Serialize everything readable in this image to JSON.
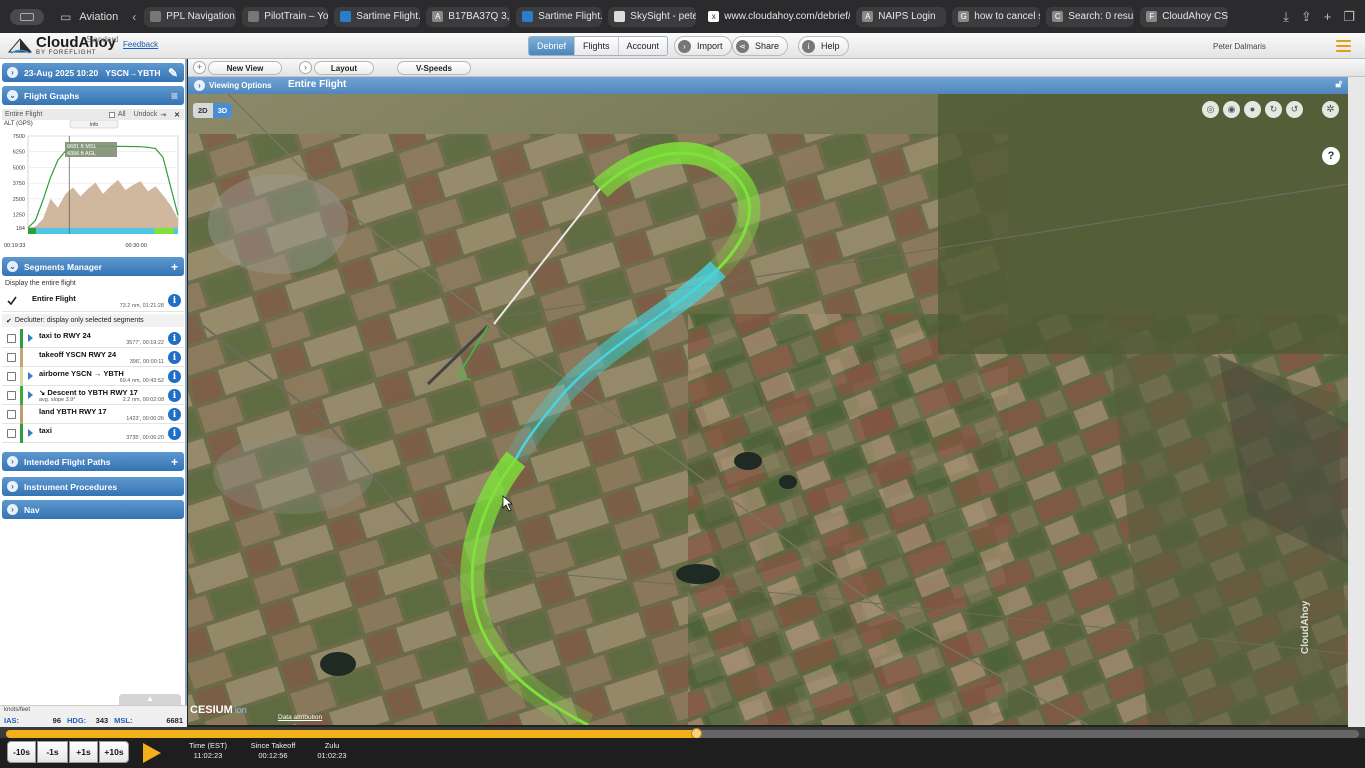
{
  "browser": {
    "tab_group": "Aviation",
    "tabs": [
      {
        "label": "PPL Navigation...",
        "fav": ""
      },
      {
        "label": "PilotTrain – You...",
        "fav": ""
      },
      {
        "label": "Sartime Flight...",
        "fav": ""
      },
      {
        "label": "B17BA37Q 3,5...",
        "fav": "A"
      },
      {
        "label": "Sartime Flight...",
        "fav": ""
      },
      {
        "label": "SkySight - pete...",
        "fav": ""
      },
      {
        "label": "www.cloudahoy.com/debrief/",
        "fav": "x"
      },
      {
        "label": "NAIPS Login",
        "fav": "A"
      },
      {
        "label": "how to cancel s...",
        "fav": "G"
      },
      {
        "label": "Search: 0 resul...",
        "fav": "C"
      },
      {
        "label": "CloudAhoy CS...",
        "fav": "F"
      }
    ]
  },
  "header": {
    "logo": "CloudAhoy",
    "logo_sub": "BY FOREFLIGHT",
    "edition": "Standard",
    "feedback": "Feedback",
    "nav": [
      "Debrief",
      "Flights",
      "Account"
    ],
    "import": "Import",
    "share": "Share",
    "help": "Help",
    "user": "Peter Dalmaris"
  },
  "flight": {
    "date": "23-Aug 2025 10:20",
    "route": "YSCN→YBTH"
  },
  "graphs": {
    "title": "Flight Graphs",
    "subtitle": "Entire Flight",
    "all": "All",
    "undock": "Undock",
    "info": "Info",
    "y_label": "ALT (GPS)",
    "tooltip_msl": "6681 ft MSL",
    "tooltip_agl": "4356 ft AGL",
    "t_start": "00:19:33",
    "t_end": "00:30:00"
  },
  "chart_data": {
    "type": "area",
    "ylabel": "ALT (GPS)",
    "yticks": [
      184,
      1250,
      2500,
      3750,
      5000,
      6250,
      7500
    ],
    "ylim": [
      184,
      7500
    ],
    "x": [
      0,
      1,
      2,
      3,
      4,
      5,
      6,
      7,
      8,
      9,
      10,
      11,
      12,
      13,
      14,
      15,
      16,
      17,
      18,
      19,
      20
    ],
    "series": [
      {
        "values": [
          184,
          800,
          2400,
          4200,
          5600,
          6300,
          6600,
          6680,
          6681,
          6670,
          6680,
          6675,
          6681,
          6670,
          6660,
          6650,
          6600,
          6500,
          5800,
          3500,
          1200
        ]
      },
      {
        "values": [
          184,
          300,
          900,
          2500,
          1800,
          2900,
          3400,
          2700,
          3300,
          3800,
          2900,
          3500,
          4000,
          3200,
          3600,
          3900,
          3100,
          3500,
          2800,
          2000,
          900
        ]
      }
    ]
  },
  "segments": {
    "title": "Segments Manager",
    "display_entire": "Display the entire flight",
    "entire": {
      "name": "Entire Flight",
      "info": "73.2 nm, 01:21:28"
    },
    "declutter": "Declutter: display only selected segments",
    "items": [
      {
        "name": "taxi to RWY 24",
        "info": "3577', 00:19:22",
        "color": "#2e9e3a",
        "arrow": true
      },
      {
        "name": "takeoff YSCN RWY 24",
        "info": "396', 00:00:11",
        "color": "#c9a27a",
        "arrow": false
      },
      {
        "name": "airborne YSCN → YBTH",
        "info": "69.4 nm, 00:43:52",
        "color": "#d7d7a0",
        "arrow": true
      },
      {
        "name": "↘ Descent to YBTH RWY 17",
        "info": "2.2 nm, 00:02:08",
        "sub": "avg. slope 3.9°",
        "color": "#3aaa3a",
        "arrow": true
      },
      {
        "name": "land YBTH RWY 17",
        "info": "1423', 00:00:26",
        "color": "#c49a73",
        "arrow": false
      },
      {
        "name": "taxi",
        "info": "3735', 00:06:20",
        "color": "#2e9e3a",
        "arrow": true
      }
    ]
  },
  "panels": [
    "Intended Flight Paths",
    "Instrument Procedures",
    "Nav"
  ],
  "status": {
    "units": "knots/feet",
    "ias_label": "IAS:",
    "ias": "96",
    "hdg_label": "HDG:",
    "hdg": "343",
    "msl_label": "MSL:",
    "msl": "6681"
  },
  "toolbar": {
    "new_view": "New View",
    "layout": "Layout",
    "vspeeds": "V-Speeds"
  },
  "map": {
    "viewing_options": "Viewing Options",
    "title": "Entire Flight",
    "mode_2d": "2D",
    "mode_3d": "3D",
    "cesium": "CESIUM",
    "cesium_ion": "ion",
    "attribution": "Data attribution",
    "watermark": "CloudAhoy",
    "help": "?"
  },
  "playback": {
    "progress": 0.51,
    "steps": [
      "-10s",
      "-1s",
      "+1s",
      "+10s"
    ],
    "time_label": "Time (EST)",
    "time": "11:02:23",
    "since_label": "Since Takeoff",
    "since": "00:12:56",
    "zulu_label": "Zulu",
    "zulu": "01:02:23"
  },
  "colors": {
    "accent": "#4a86bf",
    "track_green": "#6fe23a",
    "track_cyan": "#41d2dc",
    "timeline": "#f2b11b"
  }
}
